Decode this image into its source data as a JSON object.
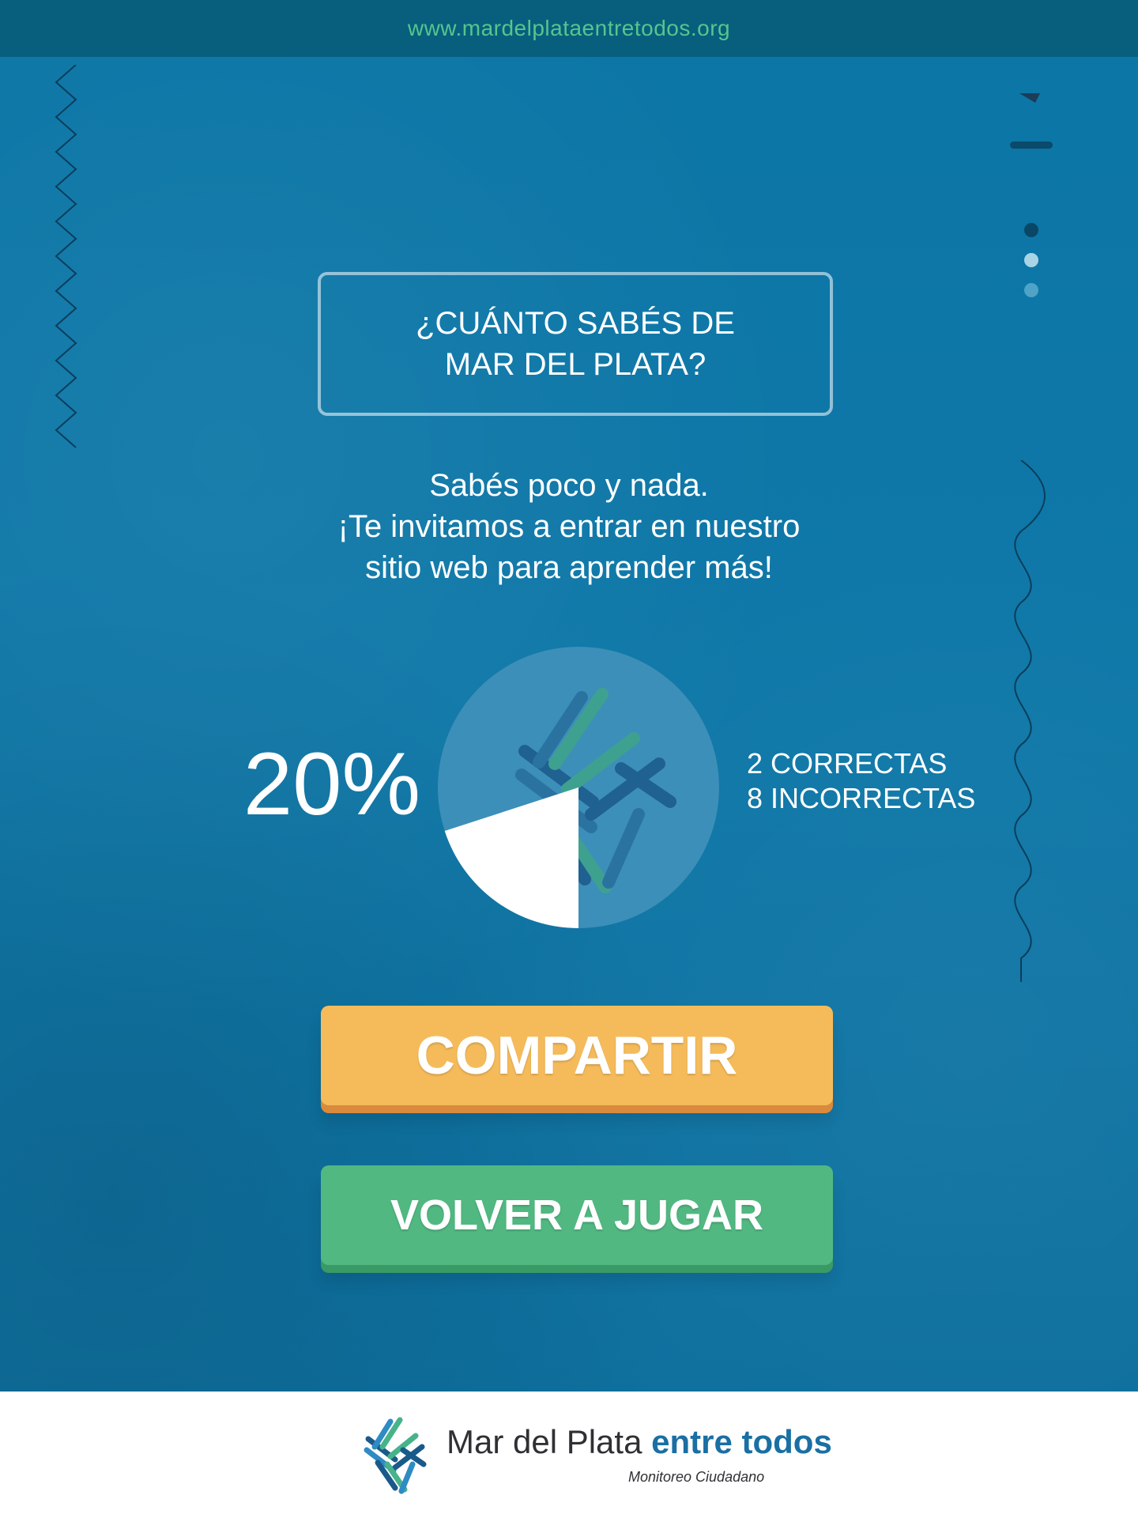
{
  "header": {
    "url": "www.mardelplataentretodos.org"
  },
  "quiz": {
    "title_line1": "¿CUÁNTO SABÉS DE",
    "title_line2": "MAR DEL PLATA?"
  },
  "result": {
    "message_line1": "Sabés poco y nada.",
    "message_line2": "¡Te invitamos a entrar en nuestro",
    "message_line3": "sitio web para aprender más!",
    "percent": "20%",
    "correct": "2 CORRECTAS",
    "incorrect": "8 INCORRECTAS",
    "correct_fraction": 0.2
  },
  "buttons": {
    "share": "COMPARTIR",
    "replay": "VOLVER A JUGAR"
  },
  "footer": {
    "brand_main": "Mar del Plata",
    "brand_accent": "entre todos",
    "tagline": "Monitoreo Ciudadano"
  },
  "colors": {
    "background": "#0f74a3",
    "topbar": "#075f7d",
    "url_text": "#57c58d",
    "share_button": "#f5bb5b",
    "replay_button": "#51b882"
  }
}
